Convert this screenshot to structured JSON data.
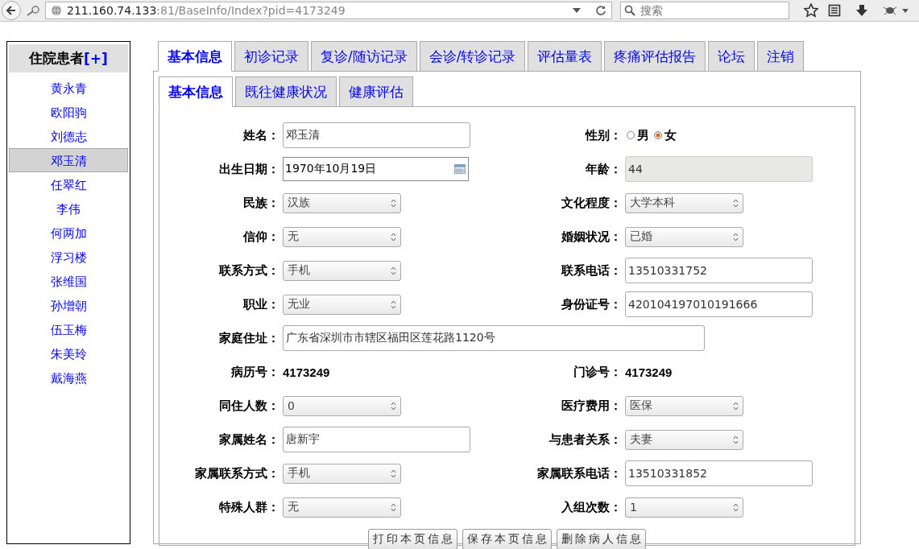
{
  "browser": {
    "url_host": "211.160.74.133",
    "url_path": ":81/BaseInfo/Index?pid=4173249",
    "search": {
      "placeholder": "搜索"
    }
  },
  "sidebar": {
    "title": "住院患者",
    "add_link": "[+]",
    "items": [
      {
        "label": "黄永青",
        "selected": false
      },
      {
        "label": "欧阳驹",
        "selected": false
      },
      {
        "label": "刘德志",
        "selected": false
      },
      {
        "label": "邓玉清",
        "selected": true
      },
      {
        "label": "任翠红",
        "selected": false
      },
      {
        "label": "李伟",
        "selected": false
      },
      {
        "label": "何两加",
        "selected": false
      },
      {
        "label": "浮习楼",
        "selected": false
      },
      {
        "label": "张维国",
        "selected": false
      },
      {
        "label": "孙增朝",
        "selected": false
      },
      {
        "label": "伍玉梅",
        "selected": false
      },
      {
        "label": "朱美玲",
        "selected": false
      },
      {
        "label": "戴海燕",
        "selected": false
      }
    ]
  },
  "tabs": [
    {
      "label": "基本信息",
      "selected": true
    },
    {
      "label": "初诊记录",
      "selected": false
    },
    {
      "label": "复诊/随访记录",
      "selected": false
    },
    {
      "label": "会诊/转诊记录",
      "selected": false
    },
    {
      "label": "评估量表",
      "selected": false
    },
    {
      "label": "疼痛评估报告",
      "selected": false
    },
    {
      "label": "论坛",
      "selected": false
    },
    {
      "label": "注销",
      "selected": false
    }
  ],
  "subtabs": [
    {
      "label": "基本信息",
      "selected": true
    },
    {
      "label": "既往健康状况",
      "selected": false
    },
    {
      "label": "健康评估",
      "selected": false
    }
  ],
  "rows": [
    [
      {
        "kind": "text",
        "label": "姓名：",
        "value": "邓玉清"
      },
      {
        "kind": "radio",
        "label": "性别：",
        "options": [
          {
            "label": "男",
            "selected": false
          },
          {
            "label": "女",
            "selected": true
          }
        ]
      }
    ],
    [
      {
        "kind": "date",
        "label": "出生日期：",
        "value": "1970年10月19日"
      },
      {
        "kind": "readonly",
        "label": "年龄：",
        "value": "44"
      }
    ],
    [
      {
        "kind": "select",
        "label": "民族：",
        "value": "汉族"
      },
      {
        "kind": "select",
        "label": "文化程度：",
        "value": "大学本科"
      }
    ],
    [
      {
        "kind": "select",
        "label": "信仰：",
        "value": "无"
      },
      {
        "kind": "select",
        "label": "婚姻状况：",
        "value": "已婚"
      }
    ],
    [
      {
        "kind": "select",
        "label": "联系方式：",
        "value": "手机"
      },
      {
        "kind": "text",
        "label": "联系电话：",
        "value": "13510331752"
      }
    ],
    [
      {
        "kind": "select",
        "label": "职业：",
        "value": "无业"
      },
      {
        "kind": "text",
        "label": "身份证号：",
        "value": "420104197010191666"
      }
    ],
    [
      {
        "kind": "address",
        "label": "家庭住址：",
        "value": "广东省深圳市市辖区福田区莲花路1120号"
      }
    ],
    [
      {
        "kind": "static",
        "label": "病历号：",
        "value": "4173249"
      },
      {
        "kind": "static",
        "label": "门诊号：",
        "value": "4173249"
      }
    ],
    [
      {
        "kind": "select",
        "label": "同住人数：",
        "value": "0"
      },
      {
        "kind": "select",
        "label": "医疗费用：",
        "value": "医保"
      }
    ],
    [
      {
        "kind": "text",
        "label": "家属姓名：",
        "value": "唐新宇"
      },
      {
        "kind": "select",
        "label": "与患者关系：",
        "value": "夫妻"
      }
    ],
    [
      {
        "kind": "select",
        "label": "家属联系方式：",
        "value": "手机"
      },
      {
        "kind": "text",
        "label": "家属联系电话：",
        "value": "13510331852"
      }
    ],
    [
      {
        "kind": "select",
        "label": "特殊人群：",
        "value": "无"
      },
      {
        "kind": "select",
        "label": "入组次数：",
        "value": "1"
      }
    ]
  ],
  "buttons": [
    "打印本页信息",
    "保存本页信息",
    "删除病人信息"
  ]
}
